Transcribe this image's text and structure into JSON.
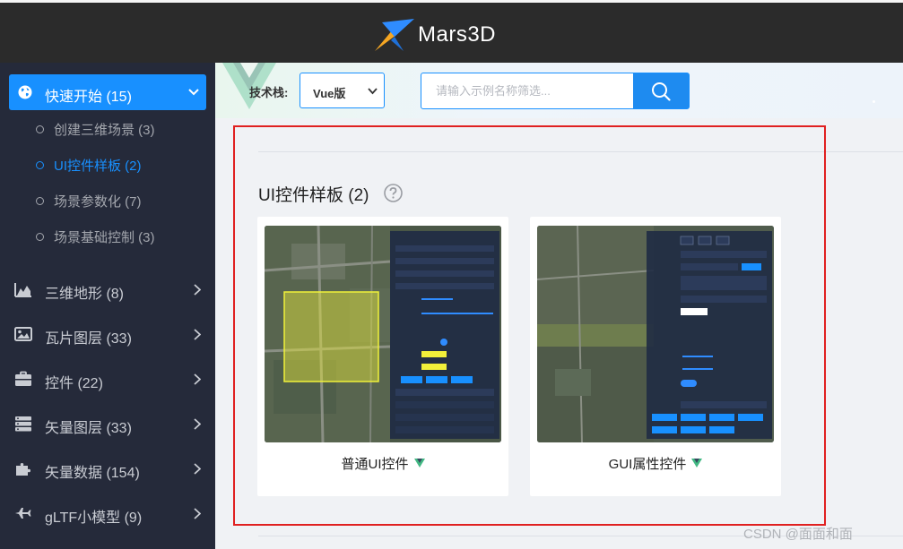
{
  "header": {
    "brand": "Mars3D"
  },
  "sidebar": {
    "active": {
      "label": "快速开始 (15)",
      "icon": "globe-icon"
    },
    "subitems": [
      {
        "label": "创建三维场景 (3)",
        "selected": false
      },
      {
        "label": "UI控件样板 (2)",
        "selected": true
      },
      {
        "label": "场景参数化 (7)",
        "selected": false
      },
      {
        "label": "场景基础控制 (3)",
        "selected": false
      }
    ],
    "items": [
      {
        "label": "三维地形 (8)",
        "icon": "terrain-chart-icon"
      },
      {
        "label": "瓦片图层 (33)",
        "icon": "image-icon"
      },
      {
        "label": "控件 (22)",
        "icon": "briefcase-icon"
      },
      {
        "label": "矢量图层 (33)",
        "icon": "server-icon"
      },
      {
        "label": "矢量数据 (154)",
        "icon": "puzzle-icon"
      },
      {
        "label": "gLTF小模型 (9)",
        "icon": "plane-icon"
      }
    ]
  },
  "toolbar": {
    "stack_label": "技术栈:",
    "stack_value": "Vue版",
    "search_placeholder": "请输入示例名称筛选..."
  },
  "content": {
    "section_title": "UI控件样板 (2)",
    "cards": [
      {
        "caption": "普通UI控件"
      },
      {
        "caption": "GUI属性控件"
      }
    ]
  },
  "watermark": "CSDN @面面和面",
  "colors": {
    "accent": "#1890ff",
    "sidebar_bg": "#252a3a",
    "header_bg": "#2b2b2b",
    "highlight": "#e02020",
    "vue_green": "#42b883"
  }
}
